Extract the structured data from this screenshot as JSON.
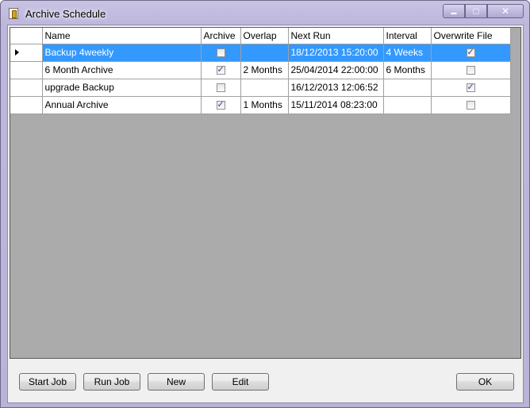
{
  "window": {
    "title": "Archive Schedule",
    "controls": {
      "minimize": "▬",
      "maximize": "□",
      "close": "✕"
    }
  },
  "grid": {
    "columns": [
      "Name",
      "Archive",
      "Overlap",
      "Next Run",
      "Interval",
      "Overwrite File"
    ],
    "rows": [
      {
        "name": "Backup 4weekly",
        "archive": false,
        "overlap": "",
        "next_run": "18/12/2013 15:20:00",
        "interval": "4 Weeks",
        "overwrite": true,
        "selected": true
      },
      {
        "name": "6 Month  Archive",
        "archive": true,
        "overlap": "2 Months",
        "next_run": "25/04/2014 22:00:00",
        "interval": "6 Months",
        "overwrite": false,
        "selected": false
      },
      {
        "name": "upgrade Backup",
        "archive": false,
        "overlap": "",
        "next_run": "16/12/2013 12:06:52",
        "interval": "",
        "overwrite": true,
        "selected": false
      },
      {
        "name": "Annual Archive",
        "archive": true,
        "overlap": "1 Months",
        "next_run": "15/11/2014 08:23:00",
        "interval": "",
        "overwrite": false,
        "selected": false
      }
    ]
  },
  "buttons": {
    "start_job": "Start Job",
    "run_job": "Run Job",
    "new": "New",
    "edit": "Edit",
    "ok": "OK"
  },
  "colors": {
    "selection": "#3399ff",
    "grid_background": "#ababab"
  }
}
